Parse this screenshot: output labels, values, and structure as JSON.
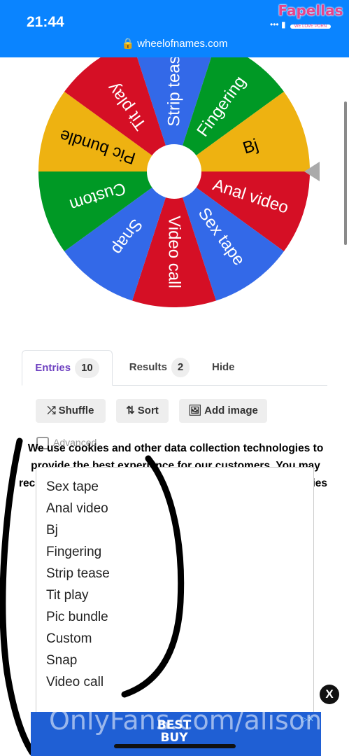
{
  "status_bar": {
    "time": "21:44",
    "signal": "••• ▮"
  },
  "browser": {
    "url": "wheelofnames.com",
    "lock_icon": "lock-icon"
  },
  "brand": {
    "name": "Fapellas",
    "tagline": "WE LOVE PORN"
  },
  "wheel": {
    "segments": [
      {
        "label": "Strip teas",
        "color": "#3369e8"
      },
      {
        "label": "Fingering",
        "color": "#009925"
      },
      {
        "label": "Bj",
        "color": "#eeb211"
      },
      {
        "label": "Anal video",
        "color": "#d50f25"
      },
      {
        "label": "Sex tape",
        "color": "#3369e8"
      },
      {
        "label": "Video call",
        "color": "#d50f25"
      },
      {
        "label": "Snap",
        "color": "#3369e8"
      },
      {
        "label": "Custom",
        "color": "#009925"
      },
      {
        "label": "Pic bundle",
        "color": "#eeb211"
      },
      {
        "label": "Tit play",
        "color": "#d50f25"
      }
    ],
    "pointer_color": "#aaaaaa"
  },
  "tabs": [
    {
      "label": "Entries",
      "count": "10"
    },
    {
      "label": "Results",
      "count": "2"
    },
    {
      "label": "Hide"
    }
  ],
  "toolbar": {
    "shuffle": "Shuffle",
    "sort": "Sort",
    "add_image": "Add image",
    "advanced": "Advanced"
  },
  "cookie_notice": {
    "line1": "We use cookies and other data collection technologies to",
    "line2": "provide the best experience for our customers. You may",
    "line3_start": "rec",
    "line3_end": "ies"
  },
  "entries": [
    "Sex tape",
    "Anal video",
    "Bj",
    "Fingering",
    "Strip tease",
    "Tit play",
    "Pic bundle",
    "Custom",
    "Snap",
    "Video call"
  ],
  "ad": {
    "logo_line1": "BEST",
    "logo_line2": "BUY",
    "close_label": "X",
    "adchoice": "▷✕"
  },
  "watermark": "OnlyFans.com/alisonlyn"
}
